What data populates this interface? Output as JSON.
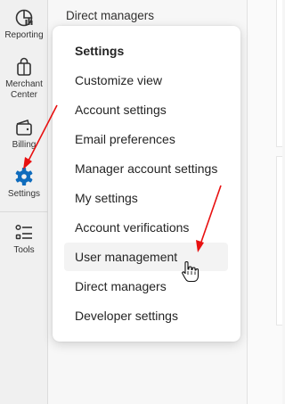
{
  "nav_rail": {
    "items": [
      {
        "label": "Reporting",
        "icon": "reporting-icon"
      },
      {
        "label": "Merchant Center",
        "icon": "merchant-bag-icon"
      },
      {
        "label": "Billing",
        "icon": "wallet-icon"
      },
      {
        "label": "Settings",
        "icon": "gear-icon",
        "active": true
      },
      {
        "label": "Tools",
        "icon": "tools-list-icon"
      }
    ]
  },
  "page": {
    "heading": "Direct managers"
  },
  "settings_menu": {
    "title": "Settings",
    "items": [
      "Customize view",
      "Account settings",
      "Email preferences",
      "Manager account settings",
      "My settings",
      "Account verifications",
      "User management",
      "Direct managers",
      "Developer settings"
    ],
    "hovered_item": "User management"
  },
  "annotations": {
    "arrow_color": "#e81010",
    "cursor_icon": "hand-pointer-icon"
  },
  "colors": {
    "accent": "#0f6cbd",
    "text": "#242424"
  }
}
